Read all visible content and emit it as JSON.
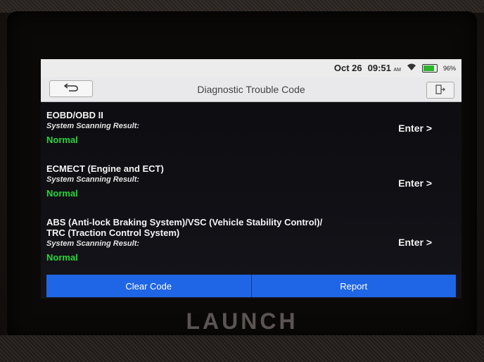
{
  "status": {
    "date": "Oct 26",
    "time": "09:51",
    "ampm": "AM",
    "battery": "96%"
  },
  "header": {
    "back_icon": "back-arrow-icon",
    "title": "Diagnostic Trouble Code",
    "exit_icon": "exit-icon"
  },
  "systems": [
    {
      "name": "EOBD/OBD II",
      "label": "System Scanning Result:",
      "status": "Normal",
      "action": "Enter >"
    },
    {
      "name": "ECMECT (Engine and ECT)",
      "label": "System Scanning Result:",
      "status": "Normal",
      "action": "Enter >"
    },
    {
      "name": "ABS (Anti-lock Braking System)/VSC (Vehicle Stability Control)/",
      "name2": "TRC (Traction Control System)",
      "label": "System Scanning Result:",
      "status": "Normal",
      "action": "Enter >"
    }
  ],
  "footer": {
    "clear_label": "Clear Code",
    "report_label": "Report"
  },
  "brand": "LAUNCH",
  "colors": {
    "status_normal": "#25d63a",
    "button_blue": "#1f66e6"
  }
}
